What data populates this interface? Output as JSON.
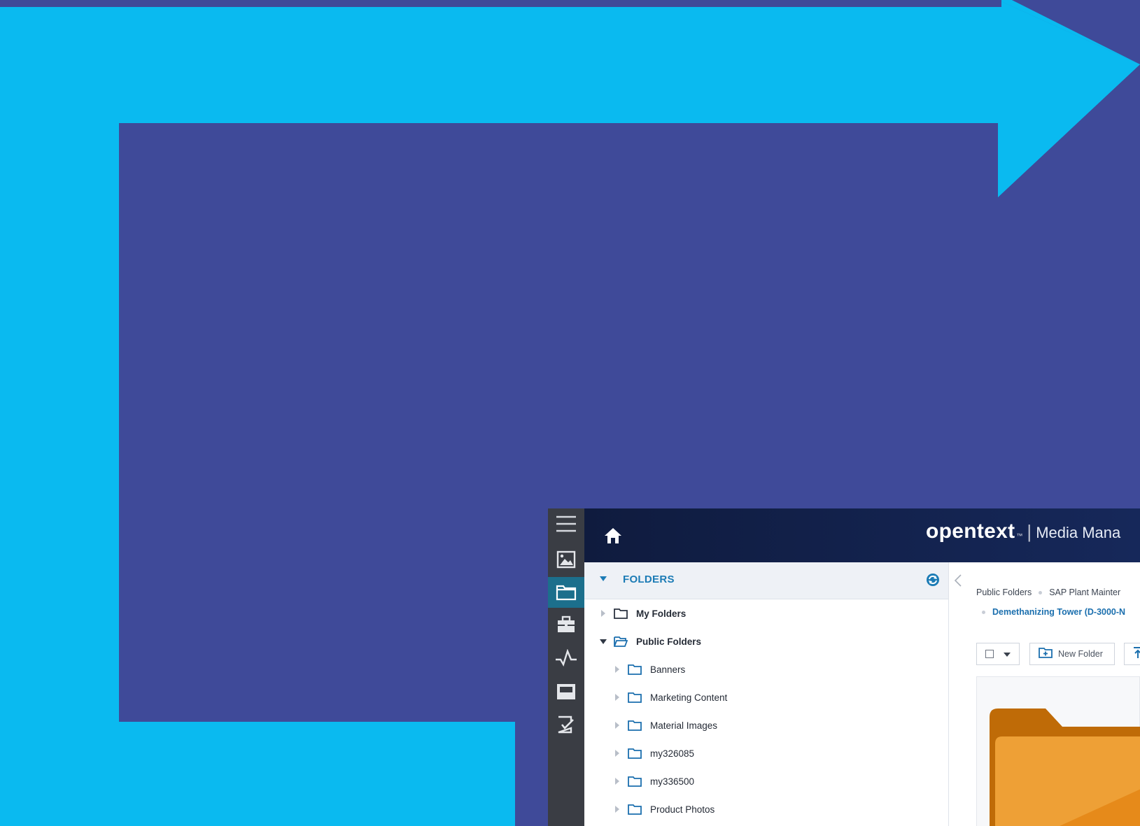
{
  "rail": {
    "items": [
      {
        "icon": "menu-icon"
      },
      {
        "icon": "image-icon"
      },
      {
        "icon": "folder-icon"
      },
      {
        "icon": "briefcase-icon"
      },
      {
        "icon": "activity-icon"
      },
      {
        "icon": "inbox-icon"
      },
      {
        "icon": "checklist-icon"
      }
    ]
  },
  "header": {
    "home_icon": "home-icon",
    "brand": "opentext",
    "trademark": "™",
    "separator": "|",
    "product": "Media Mana"
  },
  "folders_panel": {
    "title": "FOLDERS",
    "refresh_icon": "refresh-icon",
    "tree": [
      {
        "label": "My Folders",
        "expanded": false
      },
      {
        "label": "Public Folders",
        "expanded": true
      },
      {
        "label": "Banners",
        "expanded": false
      },
      {
        "label": "Marketing Content",
        "expanded": false
      },
      {
        "label": "Material Images",
        "expanded": false
      },
      {
        "label": "my326085",
        "expanded": false
      },
      {
        "label": "my336500",
        "expanded": false
      },
      {
        "label": "Product Photos",
        "expanded": false
      }
    ]
  },
  "content": {
    "breadcrumb": [
      "Public Folders",
      "SAP Plant Mainter"
    ],
    "breadcrumb_current": "Demethanizing Tower (D-3000-N",
    "toolbar": {
      "new_folder_label": "New Folder"
    }
  },
  "colors": {
    "page_bg": "#3f4a99",
    "arrow": "#0abaf0",
    "topbar": "#12214d",
    "rail": "#3a3d44",
    "accent": "#1b7bb5",
    "folder": "#e38a1c"
  }
}
